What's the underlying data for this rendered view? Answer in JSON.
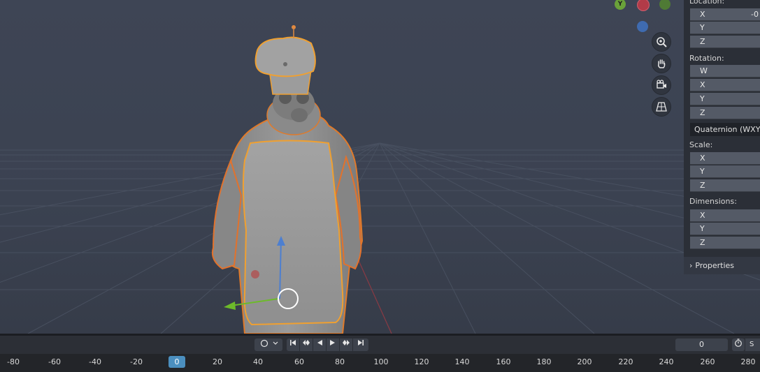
{
  "viewport": {
    "gizmo": {
      "y_label": "Y"
    }
  },
  "npanel": {
    "location_label": "Location:",
    "location": [
      {
        "axis": "X",
        "value": "-0"
      },
      {
        "axis": "Y",
        "value": ""
      },
      {
        "axis": "Z",
        "value": ""
      }
    ],
    "rotation_label": "Rotation:",
    "rotation": [
      {
        "axis": "W",
        "value": ""
      },
      {
        "axis": "X",
        "value": ""
      },
      {
        "axis": "Y",
        "value": ""
      },
      {
        "axis": "Z",
        "value": ""
      }
    ],
    "rotation_mode": "Quaternion (WXYZ)",
    "scale_label": "Scale:",
    "scale": [
      {
        "axis": "X",
        "value": ""
      },
      {
        "axis": "Y",
        "value": ""
      },
      {
        "axis": "Z",
        "value": ""
      }
    ],
    "dimensions_label": "Dimensions:",
    "dimensions": [
      {
        "axis": "X",
        "value": ""
      },
      {
        "axis": "Y",
        "value": ""
      },
      {
        "axis": "Z",
        "value": ""
      }
    ],
    "properties_label": "Properties"
  },
  "timeline": {
    "current_frame": "0",
    "current_frame_badge": "0",
    "right_label": "S",
    "ruler_ticks": [
      "-80",
      "-60",
      "-40",
      "-20",
      "0",
      "20",
      "40",
      "60",
      "80",
      "100",
      "120",
      "140",
      "160",
      "180",
      "200",
      "220",
      "240",
      "260",
      "280"
    ]
  }
}
